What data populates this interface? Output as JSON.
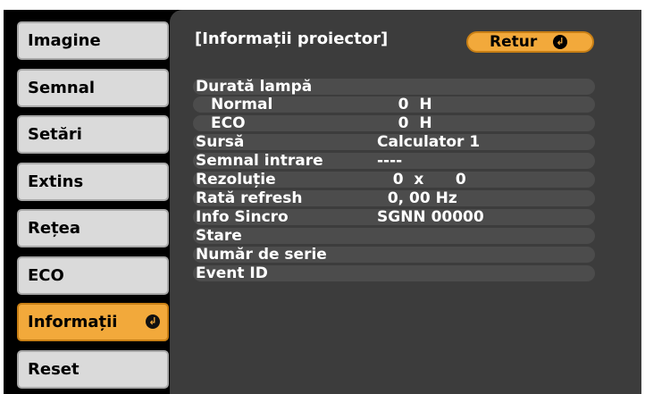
{
  "menu": {
    "items": [
      {
        "label": "Imagine"
      },
      {
        "label": "Semnal"
      },
      {
        "label": "Setări"
      },
      {
        "label": "Extins"
      },
      {
        "label": "Rețea"
      },
      {
        "label": "ECO"
      },
      {
        "label": "Informații",
        "selected": true,
        "icon": "enter-icon"
      },
      {
        "label": "Reset"
      }
    ]
  },
  "panel": {
    "title": "[Informații proiector]",
    "return_label": "Retur",
    "return_icon": "enter-icon",
    "rows": [
      {
        "label": "Durată lampă",
        "value": ""
      },
      {
        "label": "Normal",
        "value": "    0  H"
      },
      {
        "label": "ECO",
        "value": "    0  H"
      },
      {
        "label": "Sursă",
        "value": "Calculator 1"
      },
      {
        "label": "Semnal intrare",
        "value": "----"
      },
      {
        "label": "Rezoluție",
        "value": "   0  x      0"
      },
      {
        "label": "Rată refresh",
        "value": "  0, 00 Hz"
      },
      {
        "label": "Info Sincro",
        "value": "SGNN 00000"
      },
      {
        "label": "Stare",
        "value": ""
      },
      {
        "label": "Număr de serie",
        "value": ""
      },
      {
        "label": "Event ID",
        "value": ""
      }
    ]
  },
  "colors": {
    "accent": "#f2a93b",
    "menu_button": "#dadada",
    "panel_background": "#3c3c3c",
    "row_background": "#4c4c4c",
    "screen_background": "#000000"
  }
}
